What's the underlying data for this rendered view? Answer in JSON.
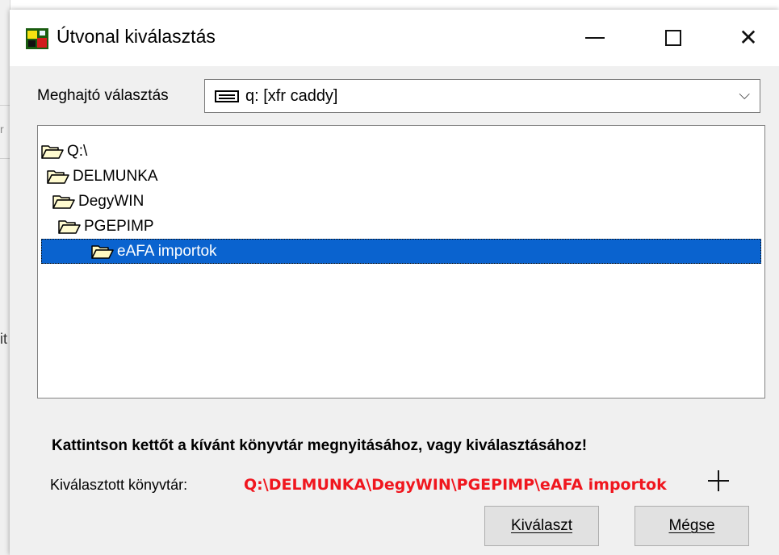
{
  "background": {
    "fragments": [
      "r",
      "it"
    ]
  },
  "window": {
    "title": "Útvonal kiválasztás",
    "controls": {
      "minimize": "minimize-icon",
      "maximize": "maximize-icon",
      "close": "close-icon",
      "close_glyph": "✕"
    }
  },
  "drive": {
    "label": "Meghajtó választás",
    "value": "q: [xfr caddy]",
    "icon": "drive-icon",
    "chevron": "⌵"
  },
  "tree": {
    "items": [
      {
        "label": "Q:\\",
        "level": 0,
        "selected": false
      },
      {
        "label": "DELMUNKA",
        "level": 1,
        "selected": false
      },
      {
        "label": "DegyWIN",
        "level": 2,
        "selected": false
      },
      {
        "label": "PGEPIMP",
        "level": 3,
        "selected": false
      },
      {
        "label": "eAFA importok",
        "level": 4,
        "selected": true
      }
    ],
    "selection_color": "#0a63cf"
  },
  "hint": "Kattintson kettőt a kívánt könyvtár megnyitásához, vagy kiválasztásához!",
  "selected_dir": {
    "label": "Kiválasztott könyvtár:",
    "path": "Q:\\DELMUNKA\\DegyWIN\\PGEPIMP\\eAFA importok",
    "color": "#f0161e"
  },
  "buttons": {
    "select": "Kiválaszt",
    "cancel": "Mégse"
  }
}
